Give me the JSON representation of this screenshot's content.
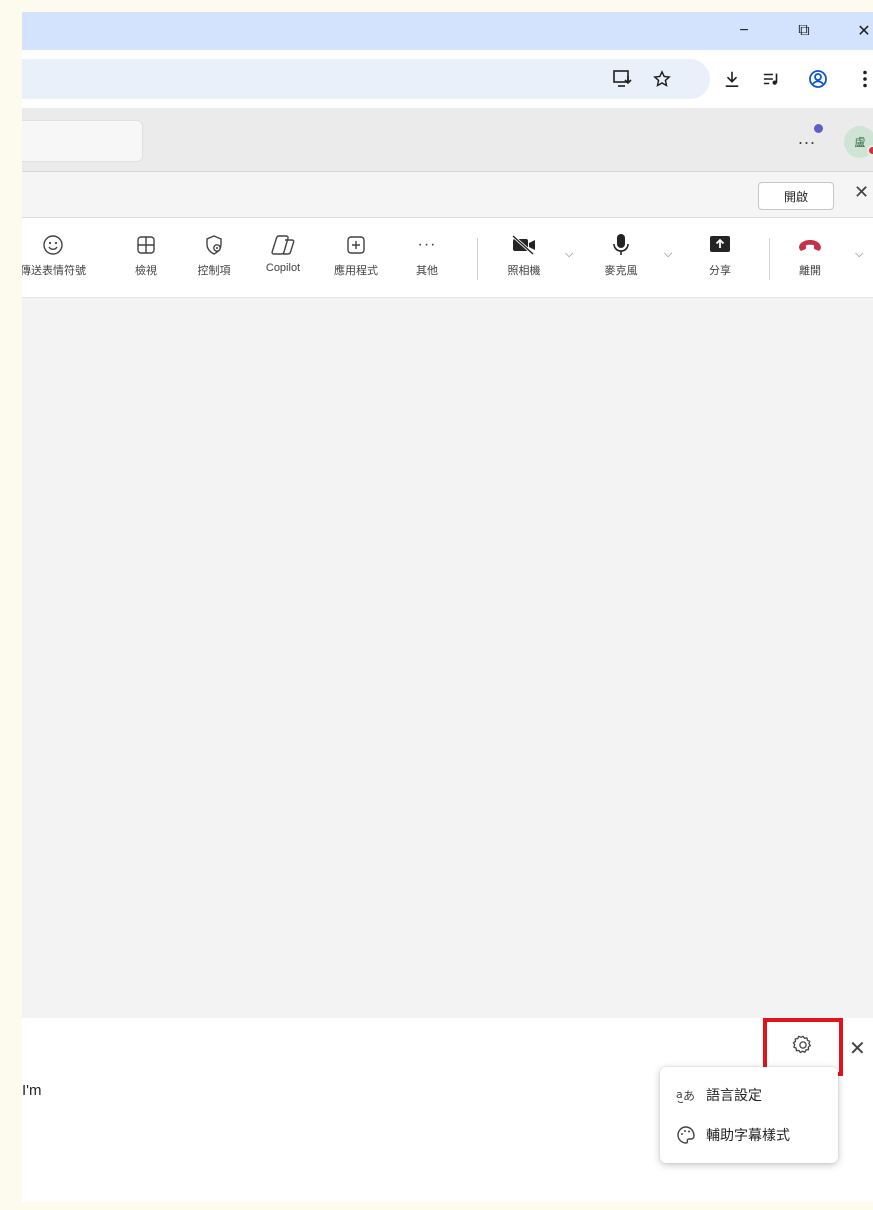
{
  "browser": {
    "minimize_glyph": "−",
    "restore_glyph": "⧉",
    "close_glyph": "✕",
    "toolbar_icons": [
      "install-app-icon",
      "bookmark-star-icon",
      "download-icon",
      "media-control-icon",
      "profile-icon",
      "kebab-menu-icon"
    ]
  },
  "teams_header": {
    "more_glyph": "...",
    "avatar_initial": "盧"
  },
  "notice": {
    "open_label": "開啟",
    "close_glyph": "✕"
  },
  "meeting_toolbar": {
    "items": [
      {
        "icon": "emoji-icon",
        "label": "傳送表情符號"
      },
      {
        "icon": "view-grid-icon",
        "label": "檢視"
      },
      {
        "icon": "shield-settings-icon",
        "label": "控制項"
      },
      {
        "icon": "copilot-icon",
        "label": "Copilot"
      },
      {
        "icon": "add-app-icon",
        "label": "應用程式"
      },
      {
        "icon": "more-icon",
        "label": "其他"
      },
      {
        "icon": "camera-off-icon",
        "label": "照相機"
      },
      {
        "icon": "microphone-icon",
        "label": "麥克風"
      },
      {
        "icon": "share-icon",
        "label": "分享"
      },
      {
        "icon": "hang-up-icon",
        "label": "離開"
      }
    ],
    "more_glyph": "···",
    "chevron_glyph": "⌵"
  },
  "captions": {
    "caption_text": "I'm",
    "close_glyph": "✕",
    "menu": [
      {
        "icon": "language-icon",
        "label": "語言設定"
      },
      {
        "icon": "palette-icon",
        "label": "輔助字幕樣式"
      }
    ]
  },
  "colors": {
    "browser_frame": "#d3e3fd",
    "highlight": "#e1141c",
    "hang_up": "#c4314b",
    "status_dot": "#5b5fc7"
  }
}
